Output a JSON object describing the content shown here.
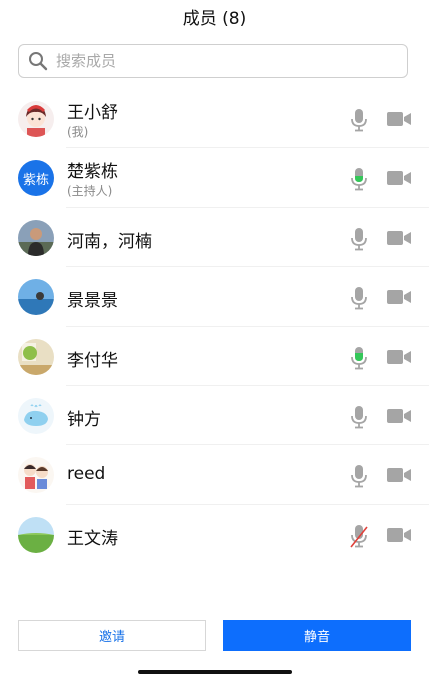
{
  "header": {
    "title": "成员 (8)"
  },
  "search": {
    "placeholder": "搜索成员"
  },
  "members": [
    {
      "name": "王小舒",
      "sub": "(我)",
      "avatar": "avatar-girl-illustration",
      "mic": "off-idle"
    },
    {
      "name": "楚紫栋",
      "sub": "(主持人)",
      "avatar_text": "紫栋",
      "mic": "speaking"
    },
    {
      "name": "河南，河楠",
      "avatar": "avatar-man-photo",
      "mic": "idle"
    },
    {
      "name": "景景景",
      "avatar": "avatar-sea-photo",
      "mic": "idle"
    },
    {
      "name": "李付华",
      "avatar": "avatar-room-photo",
      "mic": "speaking"
    },
    {
      "name": "钟方",
      "avatar": "avatar-whale-illustration",
      "mic": "idle"
    },
    {
      "name": "reed",
      "avatar": "avatar-cartoon-couple",
      "mic": "idle"
    },
    {
      "name": "王文涛",
      "avatar": "avatar-field-photo",
      "mic": "muted"
    }
  ],
  "footer": {
    "invite_label": "邀请",
    "mute_label": "静音"
  },
  "colors": {
    "accent": "#0d6efd",
    "speaking": "#34c759",
    "icon_gray": "#a5a5a5",
    "muted_slash": "#e0403a"
  }
}
